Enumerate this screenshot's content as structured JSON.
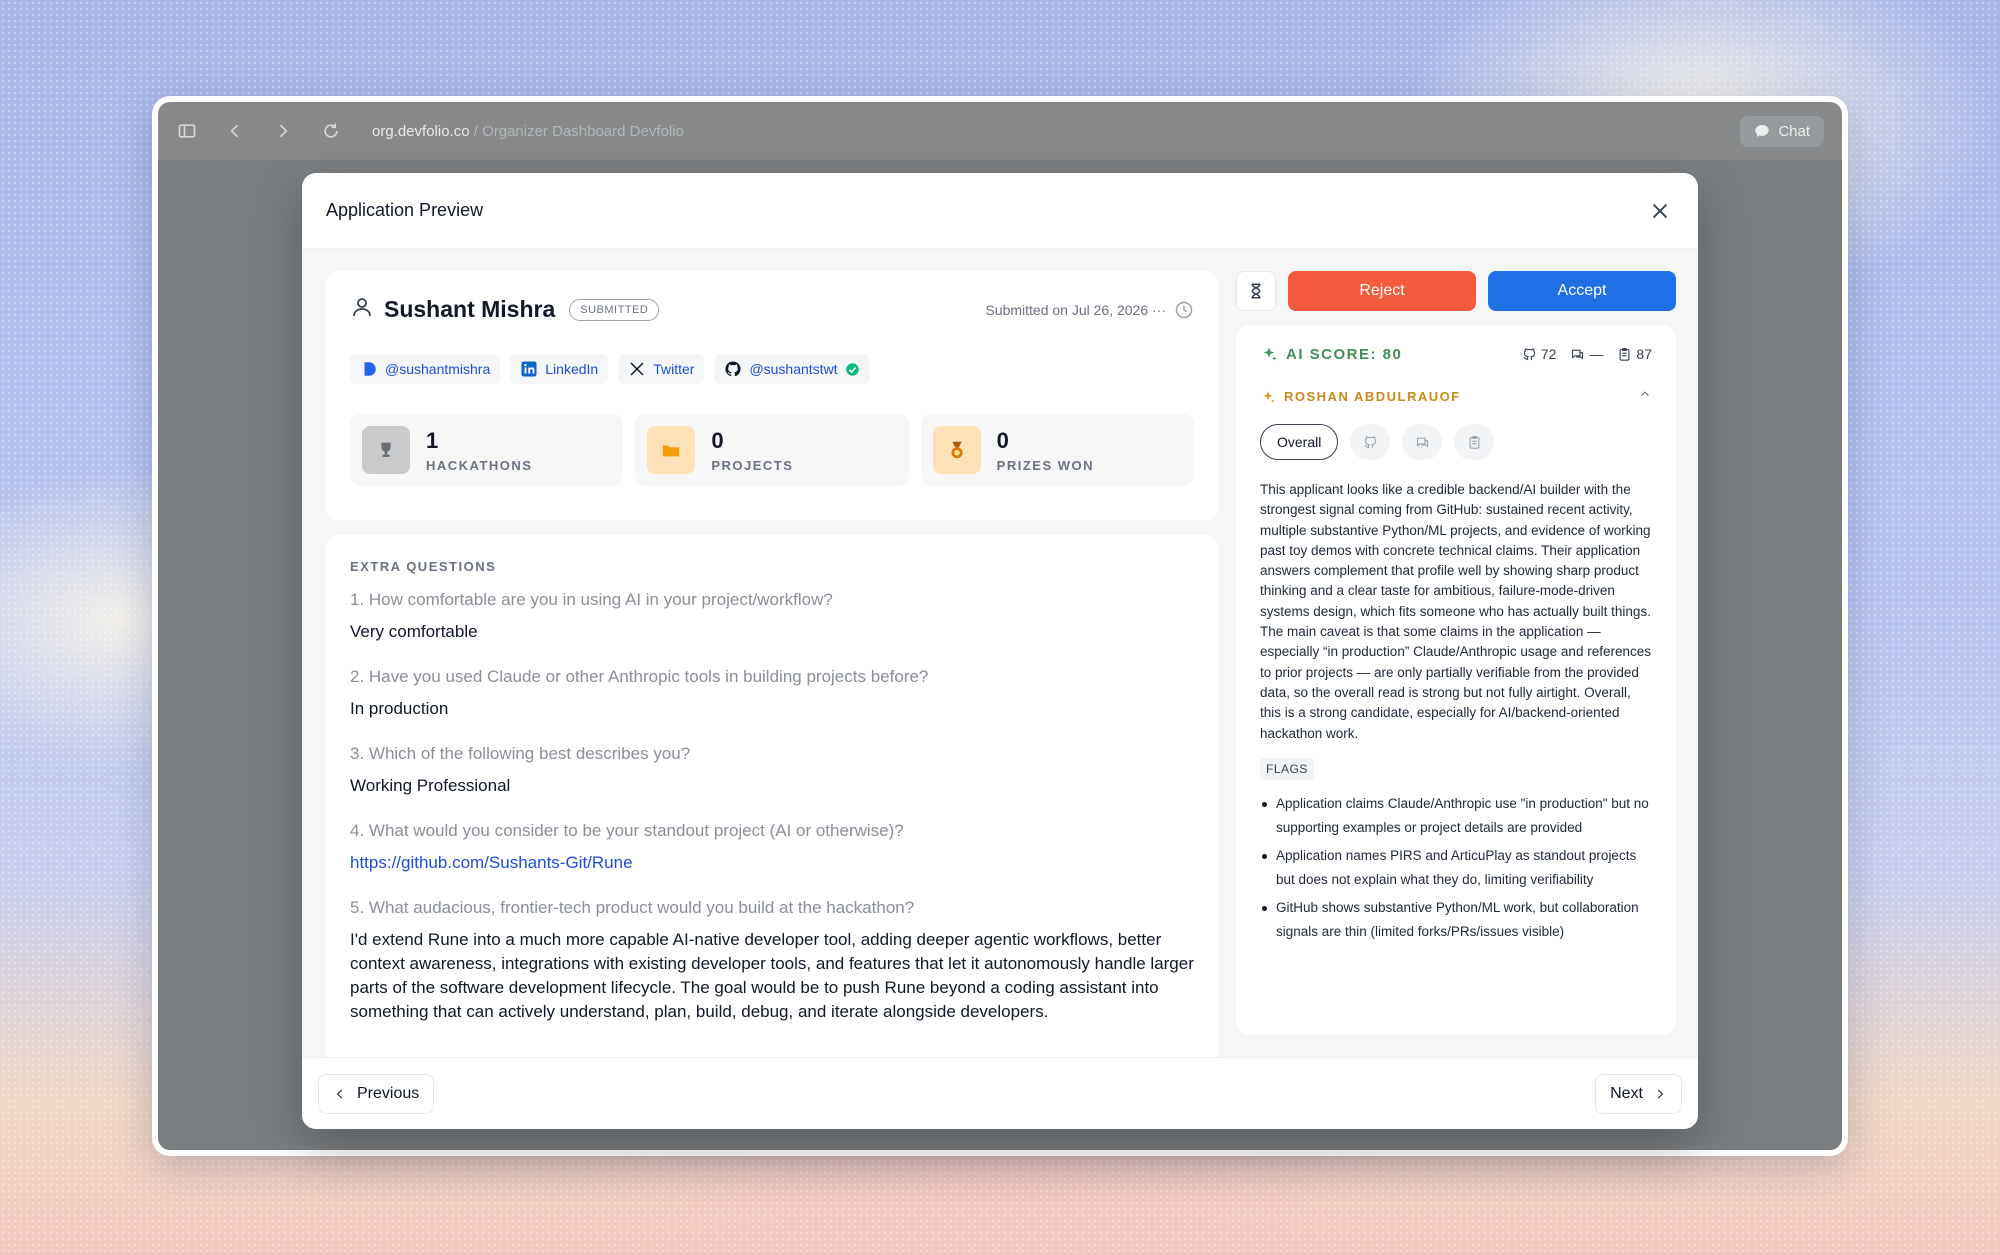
{
  "browser": {
    "url_host": "org.devfolio.co",
    "url_title": " / Organizer Dashboard Devfolio",
    "chat_label": "Chat"
  },
  "modal": {
    "title": "Application Preview",
    "previous_label": "Previous",
    "next_label": "Next"
  },
  "profile": {
    "name": "Sushant Mishra",
    "status": "SUBMITTED",
    "submitted_text": "Submitted on Jul 26, 2026 ···",
    "links": [
      {
        "label": "@sushantmishra",
        "icon": "devfolio-icon"
      },
      {
        "label": "LinkedIn",
        "icon": "linkedin-icon"
      },
      {
        "label": "Twitter",
        "icon": "x-icon"
      },
      {
        "label": "@sushantstwt",
        "icon": "github-icon"
      }
    ],
    "stats": [
      {
        "value": "1",
        "label": "HACKATHONS",
        "color": "#c9cacc"
      },
      {
        "value": "0",
        "label": "PROJECTS",
        "color": "#fde2b8"
      },
      {
        "value": "0",
        "label": "PRIZES WON",
        "color": "#fde2b8"
      }
    ]
  },
  "questions": {
    "title": "EXTRA QUESTIONS",
    "items": [
      {
        "q": "1. How comfortable are you in using AI in your project/workflow?",
        "a": "Very comfortable"
      },
      {
        "q": "2. Have you used Claude or other Anthropic tools in building projects before?",
        "a": "In production"
      },
      {
        "q": "3. Which of the following best describes you?",
        "a": "Working Professional"
      },
      {
        "q": "4. What would you consider to be your standout project (AI or otherwise)?",
        "a": "https://github.com/Sushants-Git/Rune"
      },
      {
        "q": "5. What audacious, frontier-tech product would you build at the hackathon?",
        "a": "I'd extend Rune into a much more capable AI-native developer tool, adding deeper agentic workflows, better context awareness, integrations with existing developer tools, and features that let it autonomously handle larger parts of the software development lifecycle. The goal would be to push Rune beyond a coding assistant into something that can actively understand, plan, build, debug, and iterate alongside developers."
      }
    ]
  },
  "actions": {
    "reject_label": "Reject",
    "accept_label": "Accept",
    "reject_color": "#f45a3c",
    "accept_color": "#1f6fe5"
  },
  "ai": {
    "score_label": "AI SCORE: 80",
    "metrics": [
      {
        "icon": "github-icon",
        "value": "72"
      },
      {
        "icon": "chat-icon",
        "value": "—"
      },
      {
        "icon": "clipboard-icon",
        "value": "87"
      }
    ],
    "reviewer": "ROSHAN ABDULRAUOF",
    "tab_overall": "Overall",
    "summary": "This applicant looks like a credible backend/AI builder with the strongest signal coming from GitHub: sustained recent activity, multiple substantive Python/ML projects, and evidence of working past toy demos with concrete technical claims. Their application answers complement that profile well by showing sharp product thinking and a clear taste for ambitious, failure-mode-driven systems design, which fits someone who has actually built things. The main caveat is that some claims in the application — especially “in production” Claude/Anthropic usage and references to prior projects — are only partially verifiable from the provided data, so the overall read is strong but not fully airtight. Overall, this is a strong candidate, especially for AI/backend-oriented hackathon work.",
    "flags_label": "FLAGS",
    "flags": [
      "Application claims Claude/Anthropic use \"in production\" but no supporting examples or project details are provided",
      "Application names PIRS and ArticuPlay as standout projects but does not explain what they do, limiting verifiability",
      "GitHub shows substantive Python/ML work, but collaboration signals are thin (limited forks/PRs/issues visible)"
    ]
  }
}
